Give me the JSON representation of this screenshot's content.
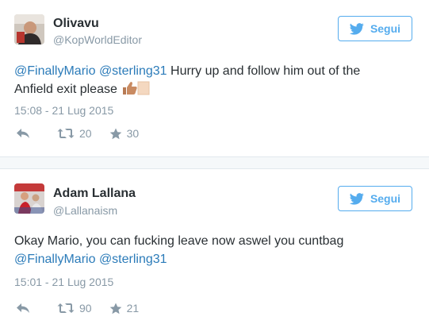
{
  "tweets": [
    {
      "name": "Olivavu",
      "handle": "@KopWorldEditor",
      "follow_label": "Segui",
      "mentions": [
        "@FinallyMario",
        "@sterling31"
      ],
      "text_line1": " Hurry up and follow him out of the",
      "text_line2": "Anfield exit please ",
      "emoji": "thumbs-up-emoji",
      "timestamp": "15:08 - 21 Lug 2015",
      "retweets": "20",
      "favorites": "30"
    },
    {
      "name": "Adam Lallana",
      "handle": "@Lallanaism",
      "follow_label": "Segui",
      "text_line1": "Okay Mario, you can fucking leave now aswel you cuntbag",
      "mentions": [
        "@FinallyMario",
        "@sterling31"
      ],
      "timestamp": "15:01 - 21 Lug 2015",
      "retweets": "90",
      "favorites": "21"
    }
  ],
  "colors": {
    "link": "#2b7bb9",
    "twitter_blue": "#55acee",
    "muted": "#8899a6",
    "text": "#292f33",
    "separator": "#f5f8fa"
  },
  "icons": [
    "bird-icon",
    "reply-icon",
    "retweet-icon",
    "star-icon"
  ]
}
